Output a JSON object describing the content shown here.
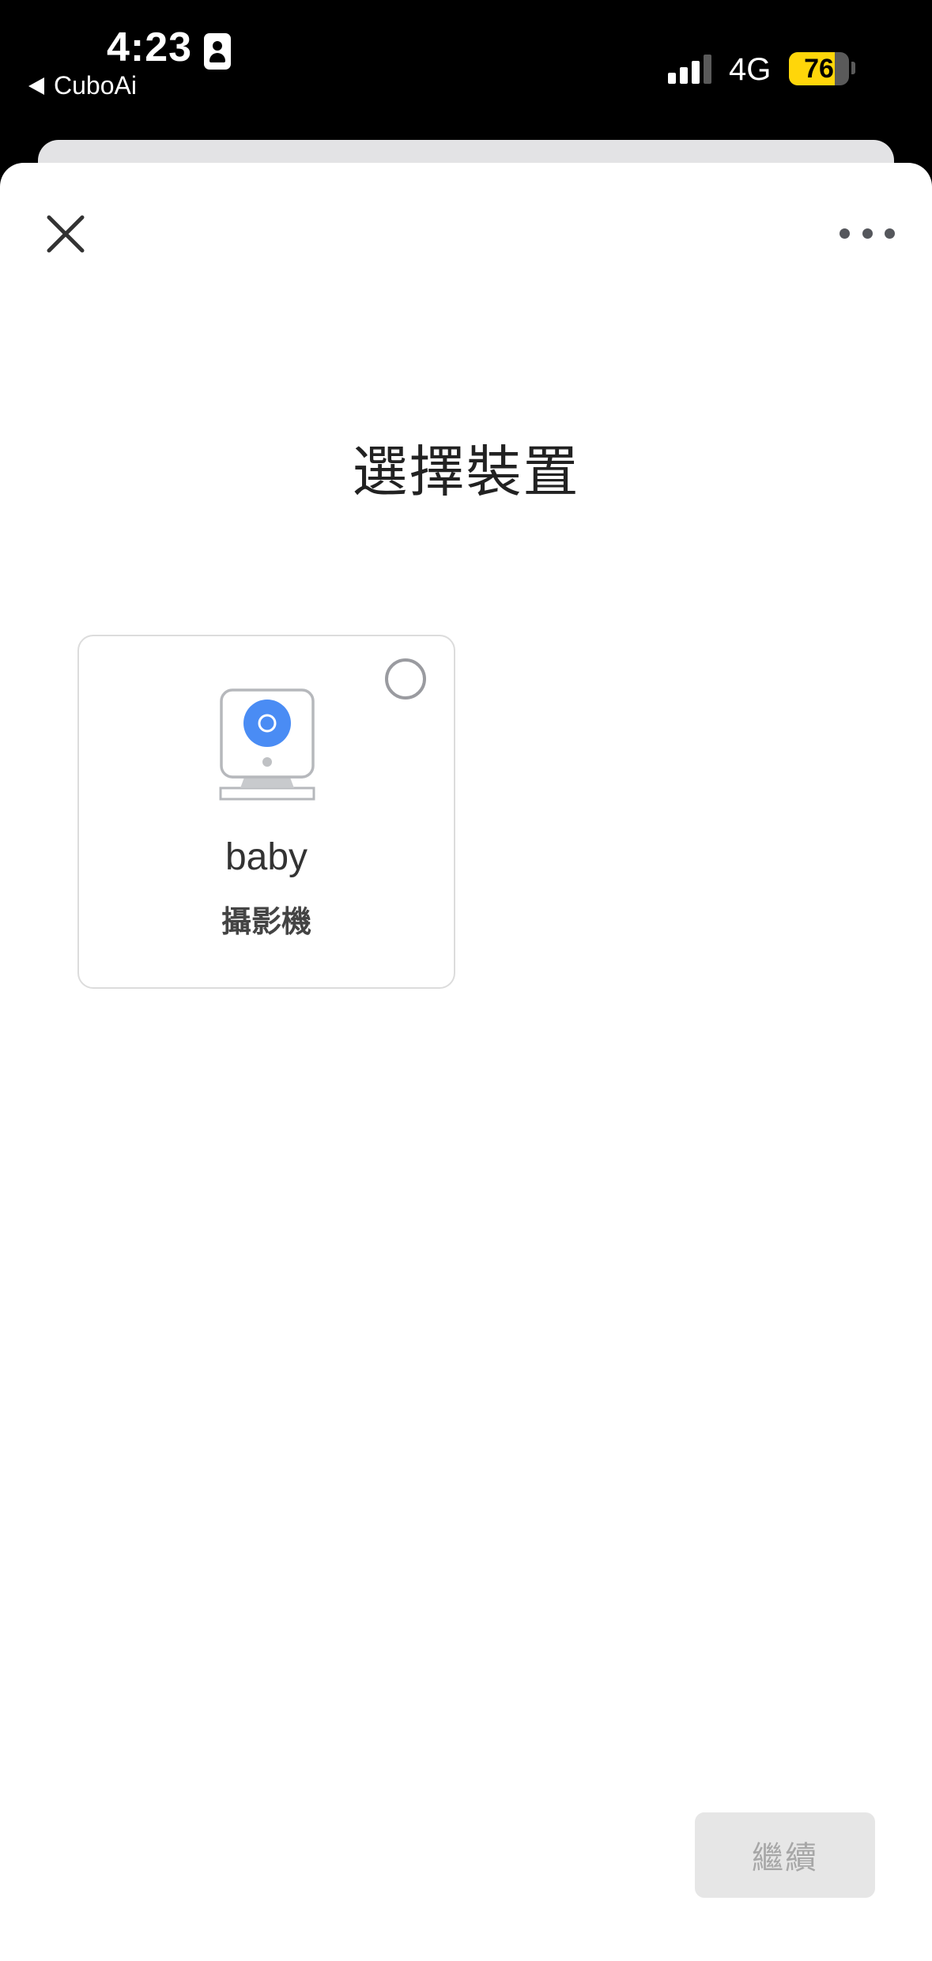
{
  "status_bar": {
    "time": "4:23",
    "back_app": "CuboAi",
    "network": "4G",
    "battery_percent": "76",
    "battery_level": 0.76,
    "signal_bars": 3
  },
  "header": {
    "close_icon": "close-icon",
    "more_icon": "more-horizontal-icon"
  },
  "page": {
    "title": "選擇裝置"
  },
  "devices": [
    {
      "name": "baby",
      "type": "攝影機",
      "icon": "camera-icon",
      "selected": false
    }
  ],
  "footer": {
    "continue_label": "繼續",
    "continue_enabled": false
  },
  "colors": {
    "accent": "#4285f4",
    "card_border": "#dcdcdc",
    "disabled_button": "#e6e6e6",
    "battery": "#ffd60a"
  }
}
